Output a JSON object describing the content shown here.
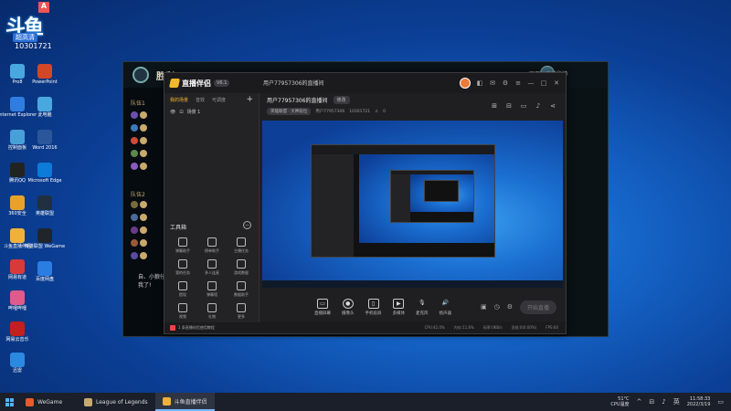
{
  "overlay": {
    "logo": "斗鱼",
    "badge": "超高清",
    "room_id": "10301721",
    "a_tag": "A"
  },
  "desktop_icons": [
    {
      "label": "Pro8",
      "color": "#4aa8e0"
    },
    {
      "label": "PowerPoint",
      "color": "#d24726"
    },
    {
      "label": "此电脑",
      "color": "#4aa8e0"
    },
    {
      "label": "Internet Explorer",
      "color": "#2f7de1"
    },
    {
      "label": "Word 2016",
      "color": "#2b579a"
    },
    {
      "label": "控制面板",
      "color": "#47a0d8"
    },
    {
      "label": "Microsoft Edge",
      "color": "#0c7bd9"
    },
    {
      "label": "腾讯QQ",
      "color": "#222"
    },
    {
      "label": "英雄联盟",
      "color": "#203040"
    },
    {
      "label": "360安全",
      "color": "#e8a22a"
    },
    {
      "label": "英雄联盟 WeGame",
      "color": "#20252c"
    },
    {
      "label": "斗鱼直播伴侣",
      "color": "#f0b13a"
    },
    {
      "label": "百度网盘",
      "color": "#2a7de1"
    },
    {
      "label": "网易有道",
      "color": "#d83a3a"
    },
    {
      "label": "哔哩哔哩",
      "color": "#e05a8a"
    },
    {
      "label": "网易云音乐",
      "color": "#c21f1f"
    },
    {
      "label": "迅雷",
      "color": "#2a8ae1"
    }
  ],
  "game": {
    "title": "胜利",
    "right_title": "四刀光刀美影帅",
    "team_label": "队伍1",
    "team2_label": "队伍2",
    "chat": "自、小狼仔",
    "chat2": "我了!"
  },
  "app": {
    "logo": "直播伴侣",
    "version": "V6.1",
    "room_name": "用户77957306的直播间",
    "edit_label": "修改",
    "left_tabs": [
      "我的场景",
      "音效",
      "可调度"
    ],
    "scene_label": "场景 1",
    "tools_title": "工具箱",
    "tools": [
      "弹幕助手",
      "榜单助手",
      "主播任务",
      "我的任务",
      "多人连麦",
      "游戏数据",
      "提现",
      "弹幕墙",
      "数据助手",
      "视频",
      "礼物",
      "更多"
    ],
    "left_footer": "1 条直播伴侣使用教程",
    "category_chip": "英雄联盟 · 大神段位",
    "meta_user": "用户77957306",
    "meta_room": "10301721",
    "meta_count": "0",
    "bottom_items": [
      "直播屏幕",
      "摄像头",
      "手机投屏",
      "多媒体",
      "麦克风",
      "扬声器"
    ],
    "start_label": "开始直播",
    "status": [
      "CPU:42.0%",
      "内存:11.6%",
      "码率:0KB/s",
      "丢帧:0(0.00%)",
      "FPS:60"
    ]
  },
  "taskbar": {
    "apps": [
      {
        "label": "WeGame",
        "color": "#e85a2a"
      },
      {
        "label": "League of Legends",
        "color": "#c8aa6e"
      },
      {
        "label": "斗鱼直播伴侣",
        "color": "#f0b13a"
      }
    ],
    "weather": "51°C",
    "weather2": "CPU温度",
    "time": "11:58:33",
    "date": "2022/3/19"
  }
}
